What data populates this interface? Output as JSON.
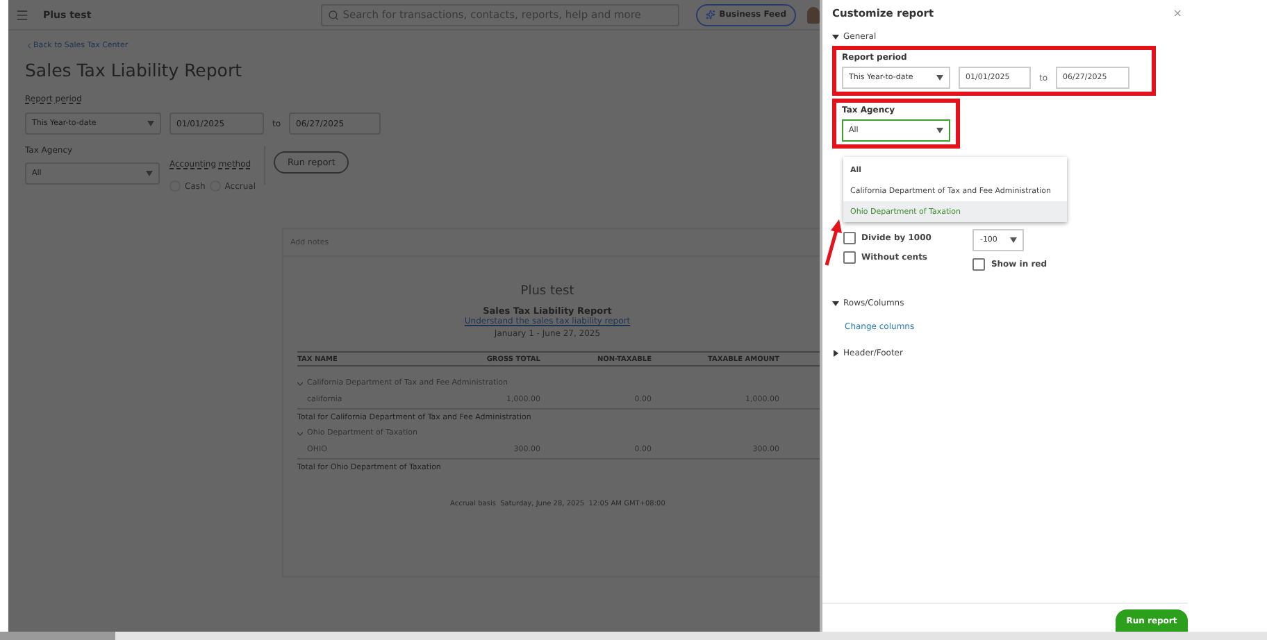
{
  "top_bar": {
    "company": "Plus test",
    "search": {
      "placeholder": "Search for transactions, contacts, reports, help and more"
    },
    "business_feed": "Business Feed"
  },
  "page": {
    "back_link": "Back to Sales Tax Center",
    "title": "Sales Tax Liability Report",
    "report_period": {
      "label": "Report period",
      "preset": "This Year-to-date",
      "from": "01/01/2025",
      "to_label": "to",
      "to": "06/27/2025"
    },
    "tax_agency": {
      "label": "Tax Agency",
      "value": "All"
    },
    "accounting_method": {
      "label": "Accounting method",
      "options": [
        {
          "label": "Cash",
          "selected": false
        },
        {
          "label": "Accrual",
          "selected": false
        }
      ]
    },
    "run_button": "Run report"
  },
  "report": {
    "notes": {
      "placeholder": "Add notes"
    },
    "company": "Plus test",
    "title": "Sales Tax Liability Report",
    "link": "Understand the sales tax liability report",
    "date_range": "January 1 - June 27, 2025",
    "columns": [
      "TAX NAME",
      "GROSS TOTAL",
      "NON-TAXABLE",
      "TAXABLE AMOUNT"
    ],
    "rows": [
      {
        "kind": "group",
        "expanded": true,
        "cells": [
          "California Department of Tax and Fee Administration"
        ]
      },
      {
        "kind": "data",
        "cells": [
          "california",
          "1,000.00",
          "0.00",
          "1,000.00"
        ]
      },
      {
        "kind": "total",
        "cells": [
          "Total for California Department of Tax and Fee Administration"
        ]
      },
      {
        "kind": "group",
        "expanded": true,
        "cells": [
          "Ohio Department of Taxation"
        ]
      },
      {
        "kind": "data",
        "cells": [
          "OHIO",
          "300.00",
          "0.00",
          "300.00"
        ]
      },
      {
        "kind": "total",
        "cells": [
          "Total for Ohio Department of Taxation"
        ]
      }
    ],
    "footer": "Accrual basis  Saturday, June 28, 2025  12:05 AM GMT+08:00"
  },
  "panel": {
    "title": "Customize report",
    "close": "×",
    "general": {
      "label": "General",
      "expanded": true
    },
    "report_period": {
      "label": "Report period",
      "preset": "This Year-to-date",
      "from": "01/01/2025",
      "to_label": "to",
      "to": "06/27/2025"
    },
    "tax_agency": {
      "label": "Tax Agency",
      "value": "All",
      "open": true,
      "options": [
        {
          "label": "All",
          "highlighted": false
        },
        {
          "label": "California Department of Tax and Fee Administration",
          "highlighted": false
        },
        {
          "label": "Ohio Department of Taxation",
          "highlighted": true
        }
      ]
    },
    "divide_by_1000": {
      "label": "Divide by 1000",
      "checked": false
    },
    "without_cents": {
      "label": "Without cents",
      "checked": false
    },
    "negative_format": {
      "value": "-100"
    },
    "show_in_red": {
      "label": "Show in red",
      "checked": false
    },
    "rows_columns": {
      "label": "Rows/Columns",
      "expanded": true,
      "link": "Change columns"
    },
    "header_footer": {
      "label": "Header/Footer",
      "expanded": false
    },
    "run_button": "Run report"
  }
}
